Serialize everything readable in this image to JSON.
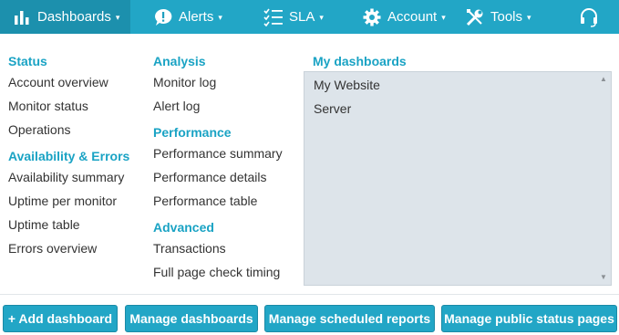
{
  "nav": {
    "items": [
      {
        "label": "Dashboards",
        "icon": "bar-chart-icon",
        "has_caret": true,
        "active": true
      },
      {
        "label": "Alerts",
        "icon": "alert-icon",
        "has_caret": true
      },
      {
        "label": "SLA",
        "icon": "checklist-icon",
        "has_caret": true
      },
      {
        "label": "Account",
        "icon": "gear-icon",
        "has_caret": true
      },
      {
        "label": "Tools",
        "icon": "tools-icon",
        "has_caret": true
      },
      {
        "label": "",
        "icon": "headset-icon",
        "has_caret": false
      }
    ],
    "caret": "▾"
  },
  "menu": {
    "status": {
      "heading": "Status",
      "links": [
        "Account overview",
        "Monitor status",
        "Operations"
      ]
    },
    "availability": {
      "heading": "Availability & Errors",
      "links": [
        "Availability summary",
        "Uptime per monitor",
        "Uptime table",
        "Errors overview"
      ]
    },
    "analysis": {
      "heading": "Analysis",
      "links": [
        "Monitor log",
        "Alert log"
      ]
    },
    "performance": {
      "heading": "Performance",
      "links": [
        "Performance summary",
        "Performance details",
        "Performance table"
      ]
    },
    "advanced": {
      "heading": "Advanced",
      "links": [
        "Transactions",
        "Full page check timing"
      ]
    }
  },
  "my_dashboards": {
    "heading": "My dashboards",
    "items": [
      "My Website",
      "Server"
    ]
  },
  "buttons": {
    "add": "+ Add dashboard",
    "manage": "Manage dashboards",
    "scheduled": "Manage scheduled reports",
    "public": "Manage public status pages"
  },
  "colors": {
    "nav_bg": "#22a6c6",
    "nav_active": "#1c90ad",
    "heading": "#1aa3c4",
    "listbox_bg": "#dde4ea"
  }
}
